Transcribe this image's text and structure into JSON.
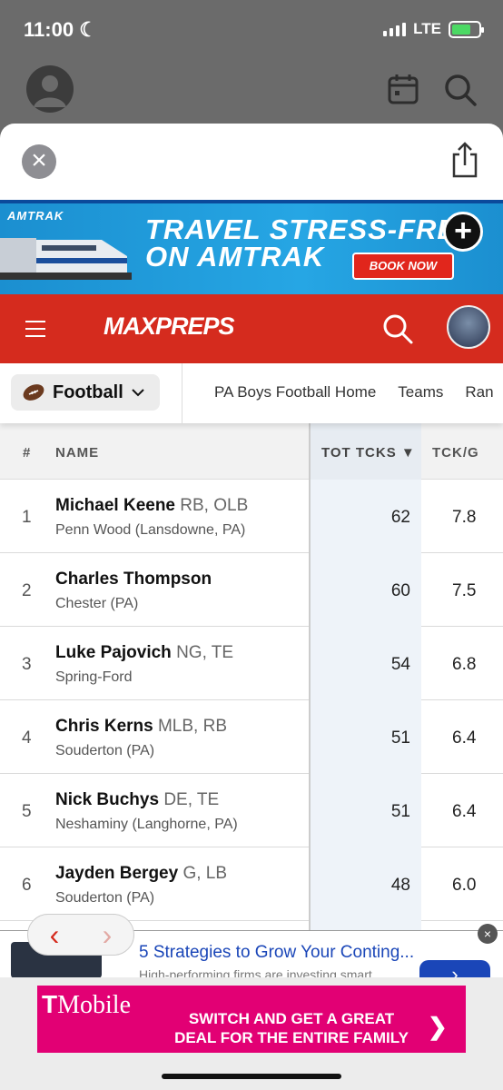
{
  "status": {
    "time": "11:00",
    "network": "LTE"
  },
  "amtrak_ad": {
    "brand": "AMTRAK",
    "headline": "TRAVEL STRESS-FRE\nON AMTRAK",
    "cta": "BOOK NOW"
  },
  "maxpreps": {
    "logo": "MAXPREPS"
  },
  "sport_nav": {
    "sport": "Football",
    "links": [
      "PA Boys Football Home",
      "Teams",
      "Ran"
    ]
  },
  "table": {
    "headers": {
      "num": "#",
      "name": "NAME",
      "tot": "TOT TCKS ▼",
      "tckg": "TCK/G"
    },
    "rows": [
      {
        "rank": "1",
        "name": "Michael Keene",
        "pos": "RB, OLB",
        "school": "Penn Wood (Lansdowne, PA)",
        "tot": "62",
        "tckg": "7.8"
      },
      {
        "rank": "2",
        "name": "Charles Thompson",
        "pos": "",
        "school": "Chester (PA)",
        "tot": "60",
        "tckg": "7.5"
      },
      {
        "rank": "3",
        "name": "Luke Pajovich",
        "pos": "NG, TE",
        "school": "Spring-Ford",
        "tot": "54",
        "tckg": "6.8"
      },
      {
        "rank": "4",
        "name": "Chris Kerns",
        "pos": "MLB, RB",
        "school": "Souderton (PA)",
        "tot": "51",
        "tckg": "6.4"
      },
      {
        "rank": "5",
        "name": "Nick Buchys",
        "pos": "DE, TE",
        "school": "Neshaminy (Langhorne, PA)",
        "tot": "51",
        "tckg": "6.4"
      },
      {
        "rank": "6",
        "name": "Jayden Bergey",
        "pos": "G, LB",
        "school": "Souderton (PA)",
        "tot": "48",
        "tckg": "6.0"
      },
      {
        "rank": "",
        "name": "",
        "pos": "",
        "school": "",
        "tot": "",
        "tckg": ""
      }
    ]
  },
  "banner_ad": {
    "title": "5 Strategies to Grow Your Conting...",
    "sub": "High-performing firms are investing smart"
  },
  "tmobile_ad": {
    "logo": "Mobile",
    "text": "SWITCH AND GET A GREAT\nDEAL FOR THE ENTIRE FAMILY",
    "arrow": "❯"
  }
}
